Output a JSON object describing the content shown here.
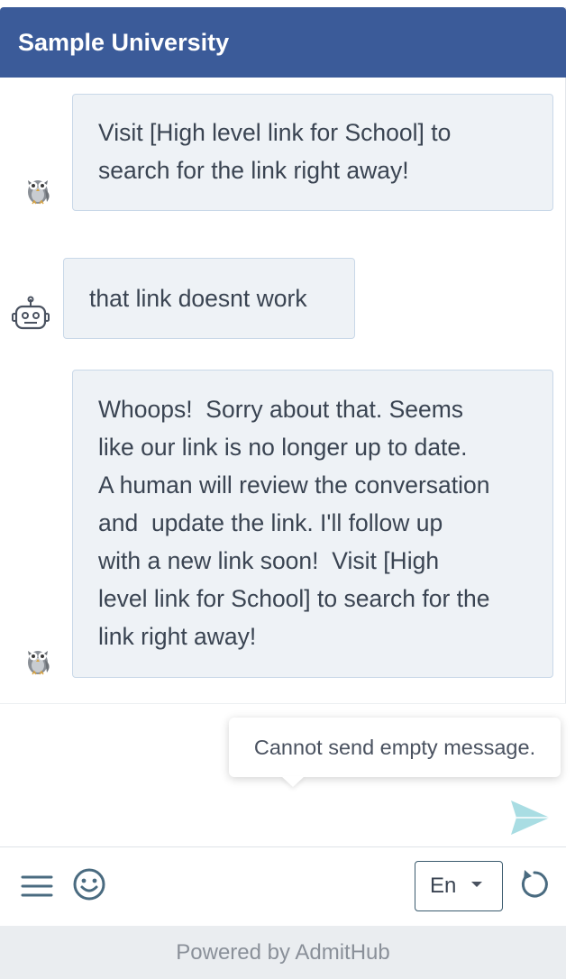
{
  "header": {
    "title": "Sample University"
  },
  "messages": [
    {
      "sender": "bot",
      "avatar_icon": "owl-icon",
      "text": "Visit [High level link for School] to\nsearch for the link right away!"
    },
    {
      "sender": "user",
      "avatar_icon": "robot-icon",
      "text": "that link doesnt work"
    },
    {
      "sender": "bot",
      "avatar_icon": "owl-icon",
      "text": "Whoops!  Sorry about that. Seems\nlike our link is no longer up to date.\nA human will review the conversation\nand  update the link. I'll follow up\nwith a new link soon!  Visit [High\nlevel link for School] to search for the\nlink right away!"
    }
  ],
  "composer": {
    "value": "",
    "tooltip": "Cannot send empty message.",
    "send_icon": "send-icon"
  },
  "toolbar": {
    "menu_icon": "hamburger-menu-icon",
    "emoji_icon": "smiley-face-icon",
    "language": "En",
    "refresh_icon": "refresh-icon"
  },
  "footer": {
    "text": "Powered by AdmitHub"
  },
  "colors": {
    "header_bg": "#3b5b99",
    "bubble_bg": "#eef2f6",
    "bubble_border": "#c9d8e8",
    "send_icon": "#a9dde3",
    "footer_bg": "#eaedf0"
  }
}
